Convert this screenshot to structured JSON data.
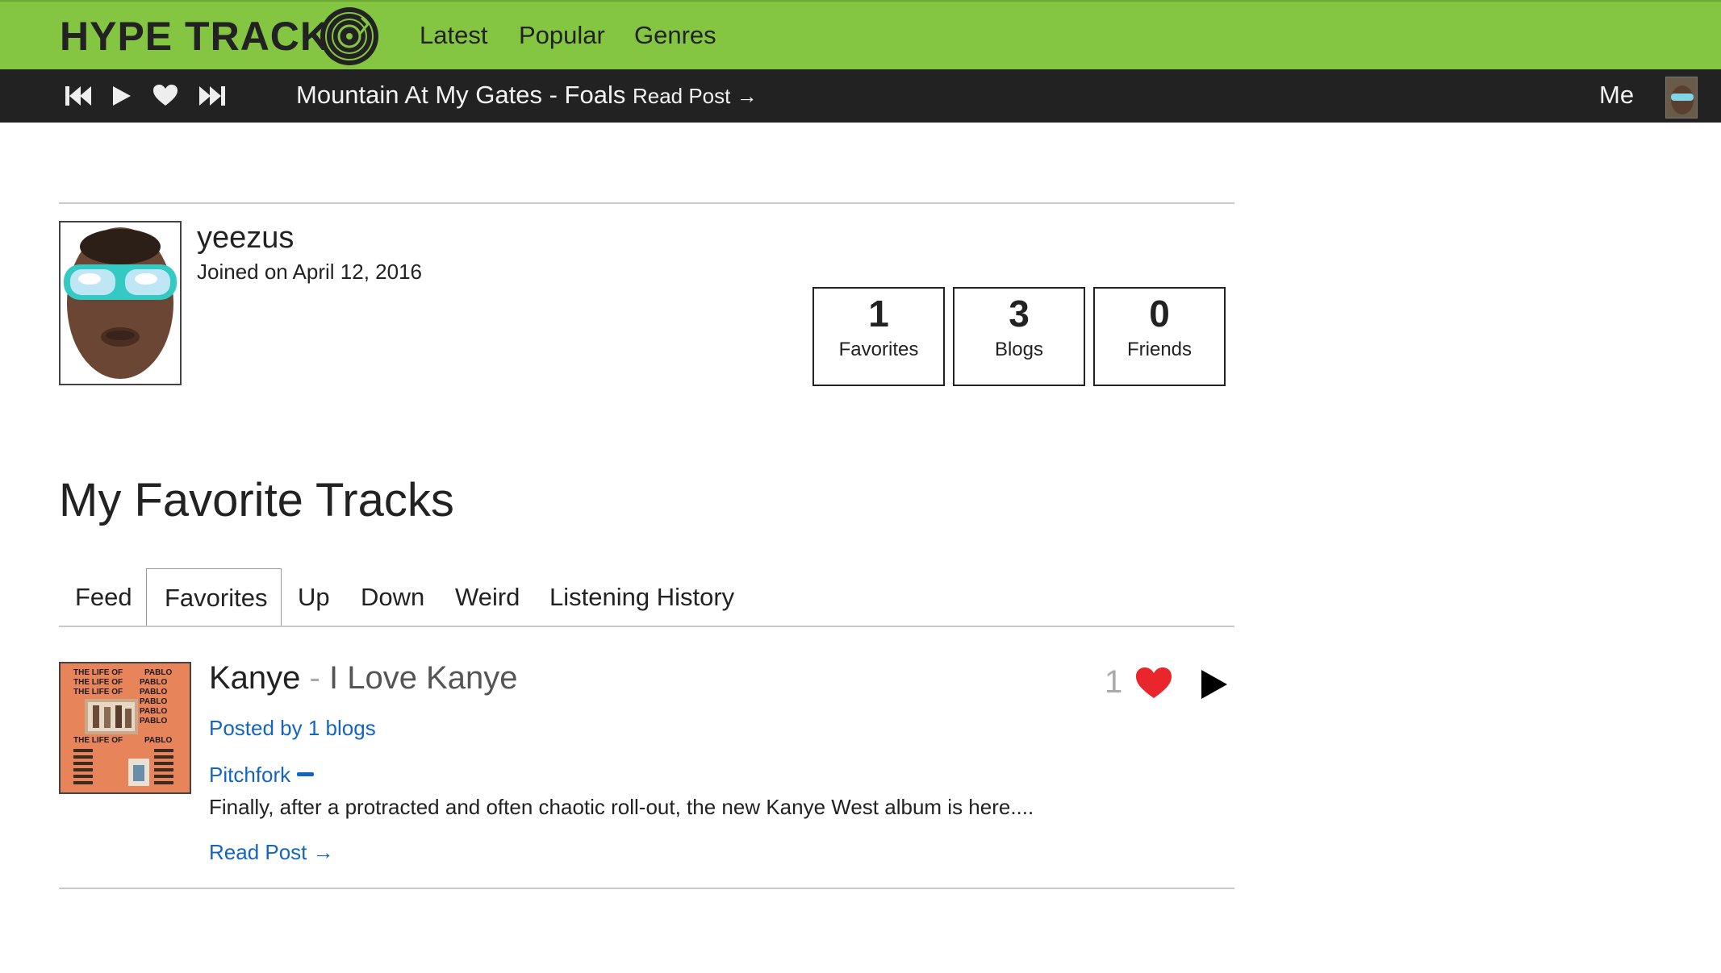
{
  "header": {
    "logo_text": "HYPE TRACK",
    "logo_icon": "vinyl-disc-icon",
    "nav": [
      {
        "label": "Latest"
      },
      {
        "label": "Popular"
      },
      {
        "label": "Genres"
      }
    ],
    "colors": {
      "brand": "#84c541",
      "player_bg": "#222222"
    }
  },
  "player": {
    "controls": [
      "previous-icon",
      "play-icon",
      "heart-icon",
      "next-icon"
    ],
    "now_playing": "Mountain At My Gates - Foals",
    "read_post": "Read Post →",
    "me_label": "Me"
  },
  "profile": {
    "username": "yeezus",
    "joined": "Joined on April 12, 2016",
    "stats": [
      {
        "value": "1",
        "label": "Favorites"
      },
      {
        "value": "3",
        "label": "Blogs"
      },
      {
        "value": "0",
        "label": "Friends"
      }
    ]
  },
  "favorites": {
    "title": "My Favorite Tracks",
    "tabs": [
      {
        "label": "Feed"
      },
      {
        "label": "Favorites",
        "active": true
      },
      {
        "label": "Up"
      },
      {
        "label": "Down"
      },
      {
        "label": "Weird"
      },
      {
        "label": "Listening History"
      }
    ],
    "tracks": [
      {
        "artist": "Kanye",
        "separator": " - ",
        "title": "I Love Kanye",
        "posted_by": "Posted by 1 blogs",
        "blog": "Pitchfork",
        "excerpt": "Finally, after a protracted and often chaotic roll-out, the new Kanye West album is here....",
        "read_post": "Read Post →",
        "favorite_count": "1",
        "album_art": {
          "left_text": "THE LIFE OF",
          "right_text": "PABLO",
          "bg_color": "#e8845a"
        }
      }
    ]
  }
}
